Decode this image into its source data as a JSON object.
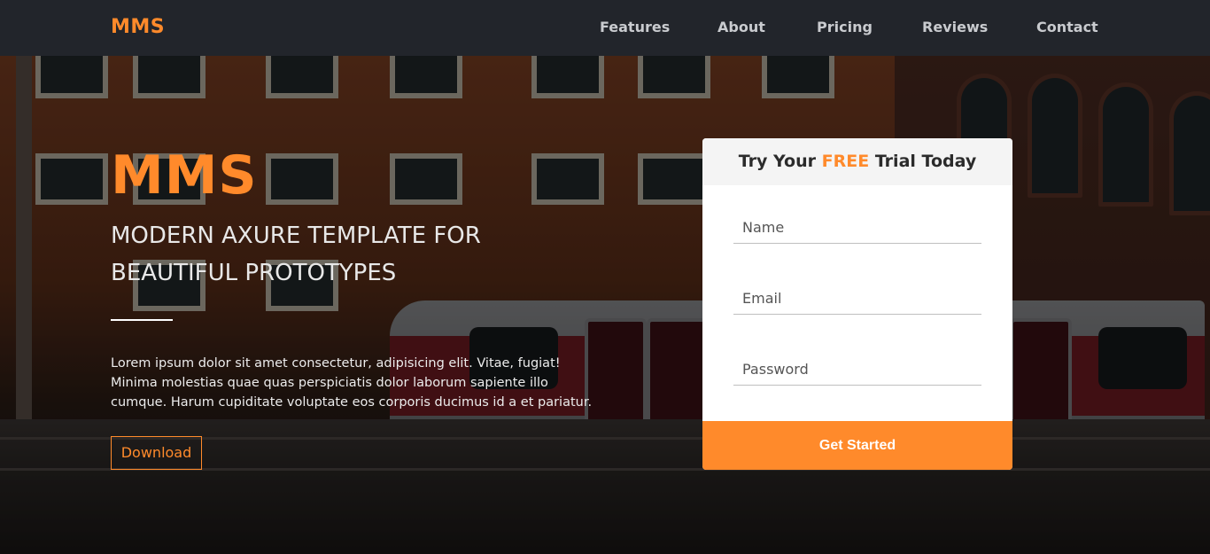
{
  "nav": {
    "brand": "MMS",
    "links": [
      "Features",
      "About",
      "Pricing",
      "Reviews",
      "Contact"
    ]
  },
  "hero": {
    "title": "MMS",
    "subtitle": "MODERN AXURE TEMPLATE FOR BEAUTIFUL PROTOTYPES",
    "description": "Lorem ipsum dolor sit amet consectetur, adipisicing elit. Vitae, fugiat! Minima molestias quae quas perspiciatis dolor laborum sapiente illo cumque. Harum cupiditate voluptate eos corporis ducimus id a et pariatur.",
    "download_label": "Download"
  },
  "form": {
    "heading_prefix": "Try Your",
    "heading_highlight": "FREE",
    "heading_suffix": "Trial Today",
    "name_placeholder": "Name",
    "email_placeholder": "Email",
    "password_placeholder": "Password",
    "submit_label": "Get Started"
  },
  "colors": {
    "accent": "#ff8a2b",
    "navbar": "#22252b"
  }
}
